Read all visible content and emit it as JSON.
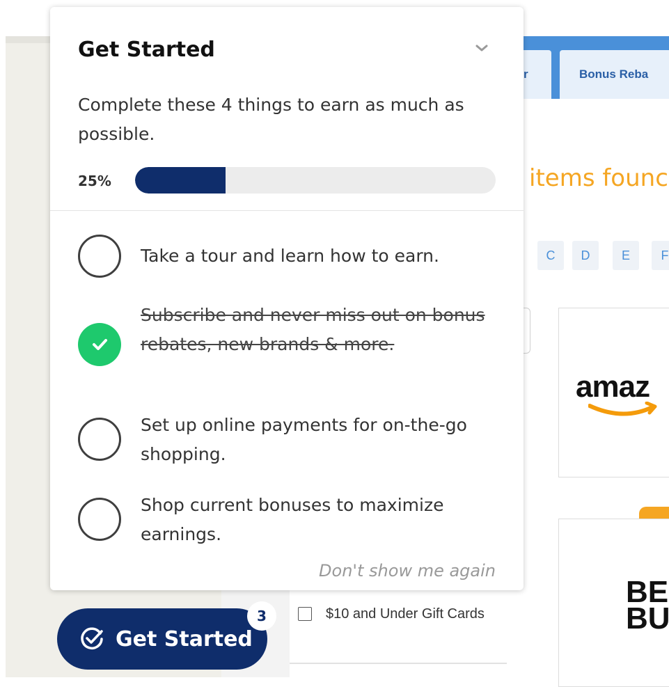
{
  "background": {
    "tabs": [
      "r",
      "Bonus Reba"
    ],
    "items_found": "items founc",
    "letters": [
      "C",
      "D",
      "E",
      "F"
    ],
    "brands": [
      {
        "logo_text": "amaz",
        "icon": "amazon-logo"
      },
      {
        "logo_text": "BE\nBU",
        "icon": "best-buy-logo"
      }
    ],
    "filter": {
      "label": "$10 and Under Gift Cards",
      "checked": false
    }
  },
  "panel": {
    "title": "Get Started",
    "description": "Complete these 4 things to earn as much as possible.",
    "progress": {
      "label": "25%",
      "value": 0.25
    },
    "tasks": [
      {
        "text": "Take a tour and learn how to earn.",
        "done": false
      },
      {
        "text": "Subscribe and never miss out on bonus rebates, new brands & more.",
        "done": true
      },
      {
        "text": "Set up online payments for on-the-go shopping.",
        "done": false
      },
      {
        "text": "Shop current bonuses to maximize earnings.",
        "done": false
      }
    ],
    "dont_show": "Don't show me again",
    "collapse_icon": "chevron-down-icon"
  },
  "launcher": {
    "label": "Get Started",
    "badge": "3",
    "icon": "check-circle-icon"
  },
  "colors": {
    "navy": "#0f2d6b",
    "green": "#1ec96d",
    "orange": "#f5a623",
    "blue": "#4a90d9"
  }
}
